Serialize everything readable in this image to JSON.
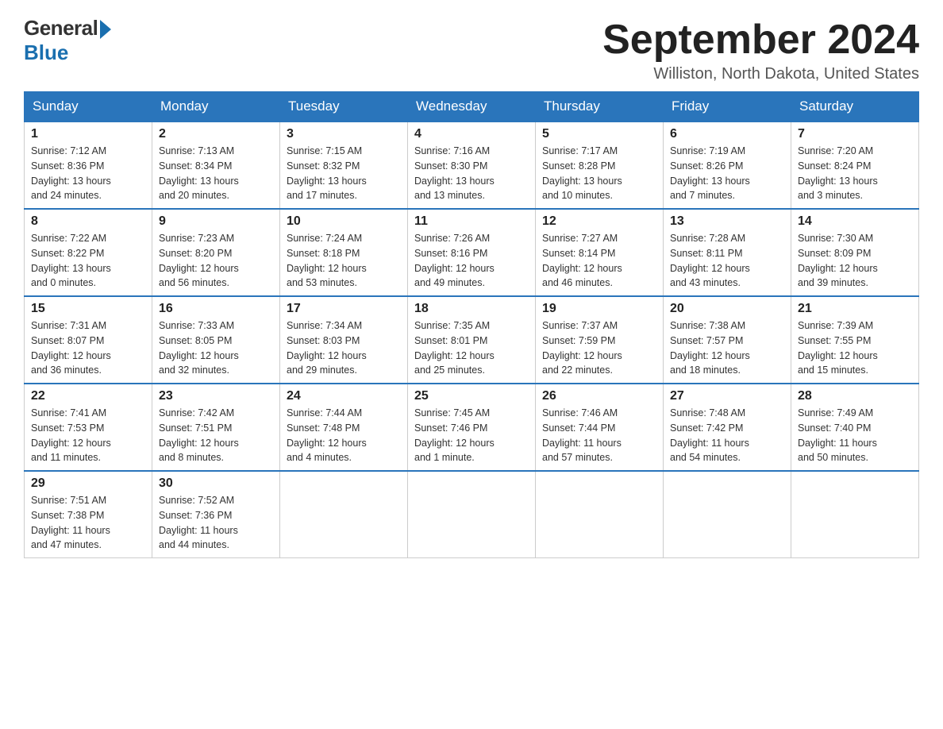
{
  "logo": {
    "general": "General",
    "blue": "Blue"
  },
  "title": "September 2024",
  "subtitle": "Williston, North Dakota, United States",
  "days_of_week": [
    "Sunday",
    "Monday",
    "Tuesday",
    "Wednesday",
    "Thursday",
    "Friday",
    "Saturday"
  ],
  "weeks": [
    [
      {
        "day": "1",
        "sunrise": "7:12 AM",
        "sunset": "8:36 PM",
        "daylight": "13 hours and 24 minutes."
      },
      {
        "day": "2",
        "sunrise": "7:13 AM",
        "sunset": "8:34 PM",
        "daylight": "13 hours and 20 minutes."
      },
      {
        "day": "3",
        "sunrise": "7:15 AM",
        "sunset": "8:32 PM",
        "daylight": "13 hours and 17 minutes."
      },
      {
        "day": "4",
        "sunrise": "7:16 AM",
        "sunset": "8:30 PM",
        "daylight": "13 hours and 13 minutes."
      },
      {
        "day": "5",
        "sunrise": "7:17 AM",
        "sunset": "8:28 PM",
        "daylight": "13 hours and 10 minutes."
      },
      {
        "day": "6",
        "sunrise": "7:19 AM",
        "sunset": "8:26 PM",
        "daylight": "13 hours and 7 minutes."
      },
      {
        "day": "7",
        "sunrise": "7:20 AM",
        "sunset": "8:24 PM",
        "daylight": "13 hours and 3 minutes."
      }
    ],
    [
      {
        "day": "8",
        "sunrise": "7:22 AM",
        "sunset": "8:22 PM",
        "daylight": "13 hours and 0 minutes."
      },
      {
        "day": "9",
        "sunrise": "7:23 AM",
        "sunset": "8:20 PM",
        "daylight": "12 hours and 56 minutes."
      },
      {
        "day": "10",
        "sunrise": "7:24 AM",
        "sunset": "8:18 PM",
        "daylight": "12 hours and 53 minutes."
      },
      {
        "day": "11",
        "sunrise": "7:26 AM",
        "sunset": "8:16 PM",
        "daylight": "12 hours and 49 minutes."
      },
      {
        "day": "12",
        "sunrise": "7:27 AM",
        "sunset": "8:14 PM",
        "daylight": "12 hours and 46 minutes."
      },
      {
        "day": "13",
        "sunrise": "7:28 AM",
        "sunset": "8:11 PM",
        "daylight": "12 hours and 43 minutes."
      },
      {
        "day": "14",
        "sunrise": "7:30 AM",
        "sunset": "8:09 PM",
        "daylight": "12 hours and 39 minutes."
      }
    ],
    [
      {
        "day": "15",
        "sunrise": "7:31 AM",
        "sunset": "8:07 PM",
        "daylight": "12 hours and 36 minutes."
      },
      {
        "day": "16",
        "sunrise": "7:33 AM",
        "sunset": "8:05 PM",
        "daylight": "12 hours and 32 minutes."
      },
      {
        "day": "17",
        "sunrise": "7:34 AM",
        "sunset": "8:03 PM",
        "daylight": "12 hours and 29 minutes."
      },
      {
        "day": "18",
        "sunrise": "7:35 AM",
        "sunset": "8:01 PM",
        "daylight": "12 hours and 25 minutes."
      },
      {
        "day": "19",
        "sunrise": "7:37 AM",
        "sunset": "7:59 PM",
        "daylight": "12 hours and 22 minutes."
      },
      {
        "day": "20",
        "sunrise": "7:38 AM",
        "sunset": "7:57 PM",
        "daylight": "12 hours and 18 minutes."
      },
      {
        "day": "21",
        "sunrise": "7:39 AM",
        "sunset": "7:55 PM",
        "daylight": "12 hours and 15 minutes."
      }
    ],
    [
      {
        "day": "22",
        "sunrise": "7:41 AM",
        "sunset": "7:53 PM",
        "daylight": "12 hours and 11 minutes."
      },
      {
        "day": "23",
        "sunrise": "7:42 AM",
        "sunset": "7:51 PM",
        "daylight": "12 hours and 8 minutes."
      },
      {
        "day": "24",
        "sunrise": "7:44 AM",
        "sunset": "7:48 PM",
        "daylight": "12 hours and 4 minutes."
      },
      {
        "day": "25",
        "sunrise": "7:45 AM",
        "sunset": "7:46 PM",
        "daylight": "12 hours and 1 minute."
      },
      {
        "day": "26",
        "sunrise": "7:46 AM",
        "sunset": "7:44 PM",
        "daylight": "11 hours and 57 minutes."
      },
      {
        "day": "27",
        "sunrise": "7:48 AM",
        "sunset": "7:42 PM",
        "daylight": "11 hours and 54 minutes."
      },
      {
        "day": "28",
        "sunrise": "7:49 AM",
        "sunset": "7:40 PM",
        "daylight": "11 hours and 50 minutes."
      }
    ],
    [
      {
        "day": "29",
        "sunrise": "7:51 AM",
        "sunset": "7:38 PM",
        "daylight": "11 hours and 47 minutes."
      },
      {
        "day": "30",
        "sunrise": "7:52 AM",
        "sunset": "7:36 PM",
        "daylight": "11 hours and 44 minutes."
      },
      null,
      null,
      null,
      null,
      null
    ]
  ],
  "labels": {
    "sunrise": "Sunrise:",
    "sunset": "Sunset:",
    "daylight": "Daylight:"
  }
}
